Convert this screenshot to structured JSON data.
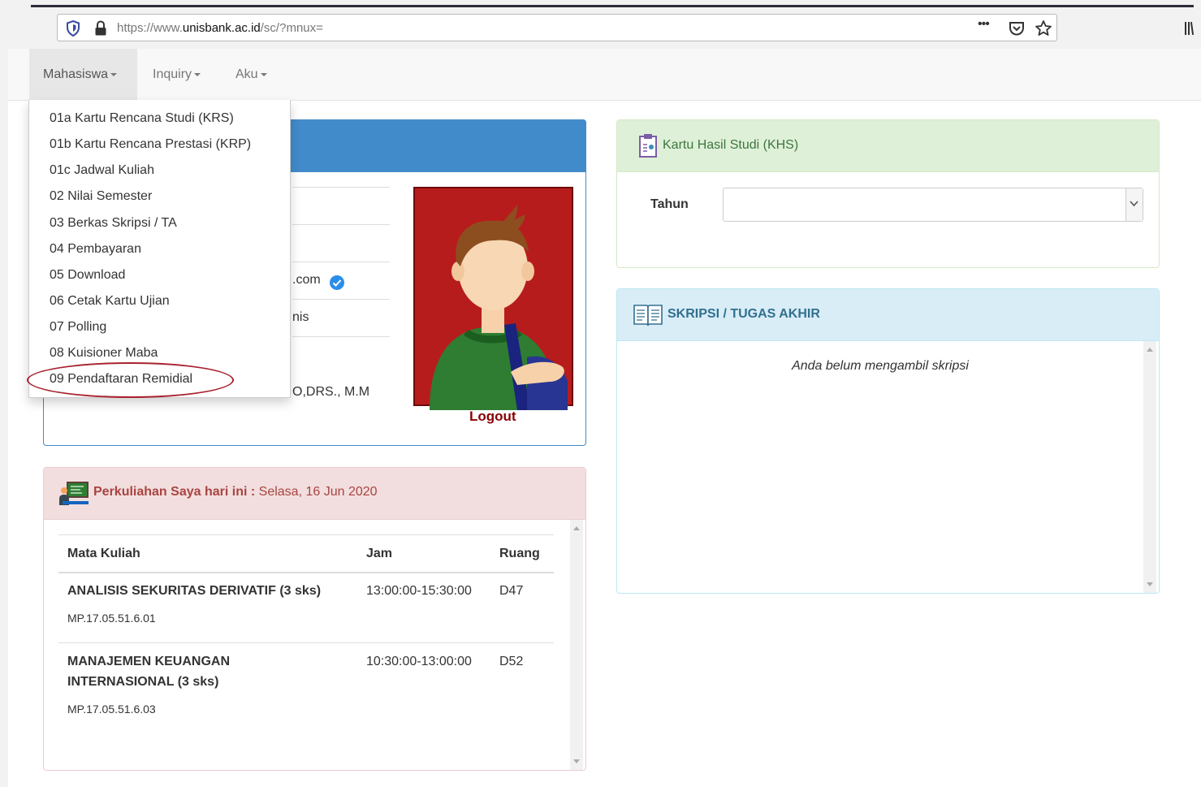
{
  "browser": {
    "url_prefix": "https://www.",
    "url_domain": "unisbank.ac.id",
    "url_path": "/sc/?mnux=",
    "more": "•••"
  },
  "nav": {
    "items": [
      {
        "label": "Mahasiswa"
      },
      {
        "label": "Inquiry"
      },
      {
        "label": "Aku"
      }
    ]
  },
  "dropdown": {
    "items": [
      "01a Kartu Rencana Studi (KRS)",
      "01b Kartu Rencana Prestasi (KRP)",
      "01c Jadwal Kuliah",
      "02 Nilai Semester",
      "03 Berkas Skripsi / TA",
      "04 Pembayaran",
      "05 Download",
      "06 Cetak Kartu Ujian",
      "07 Polling",
      "08 Kuisioner Maba",
      "09 Pendaftaran Remidial"
    ]
  },
  "profile": {
    "email_fragment": ".com",
    "fakultas_fragment": "nis",
    "dosen_fragment": "O,DRS., M.M",
    "logout": "Logout"
  },
  "schedule": {
    "title": "Perkuliahan Saya hari ini :",
    "date": "Selasa, 16 Jun 2020",
    "headers": [
      "Mata Kuliah",
      "Jam",
      "Ruang"
    ],
    "rows": [
      {
        "name": "ANALISIS SEKURITAS DERIVATIF (3 sks)",
        "code": "MP.17.05.51.6.01",
        "time": "13:00:00-15:30:00",
        "room": "D47"
      },
      {
        "name_line1": "MANAJEMEN KEUANGAN",
        "name_line2": "INTERNASIONAL (3 sks)",
        "code": "MP.17.05.51.6.03",
        "time": "10:30:00-13:00:00",
        "room": "D52"
      }
    ]
  },
  "khs": {
    "title": "Kartu Hasil Studi (KHS)",
    "year_label": "Tahun",
    "year_value": ""
  },
  "skripsi": {
    "title": "SKRIPSI / TUGAS AKHIR",
    "message": "Anda belum mengambil skripsi"
  },
  "colors": {
    "primary": "#428bca",
    "danger_bg": "#f2dede",
    "danger_text": "#a94442",
    "success_bg": "#dff0d8",
    "success_text": "#3c763d",
    "info_bg": "#d9edf7",
    "info_text": "#31708f"
  }
}
